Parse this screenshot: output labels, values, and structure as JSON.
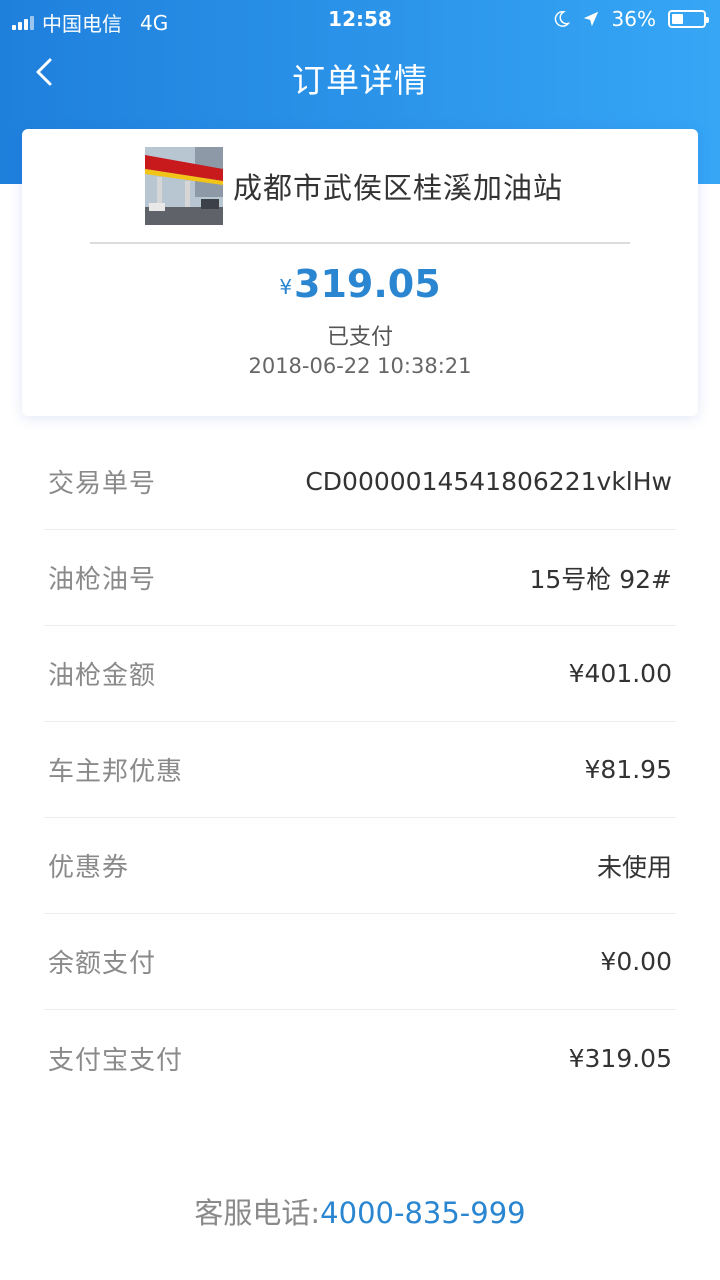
{
  "status_bar": {
    "carrier": "中国电信",
    "network": "4G",
    "time": "12:58",
    "battery": "36%",
    "battery_level": 0.36
  },
  "nav": {
    "title": "订单详情",
    "back_icon": "chevron-left-icon"
  },
  "order": {
    "station_name": "成都市武侯区桂溪加油站",
    "currency_symbol": "¥",
    "amount": "319.05",
    "status": "已支付",
    "time": "2018-06-22 10:38:21"
  },
  "details": [
    {
      "label": "交易单号",
      "value": "CD0000014541806221vklHw"
    },
    {
      "label": "油枪油号",
      "value": "15号枪 92#"
    },
    {
      "label": "油枪金额",
      "value": "¥401.00"
    },
    {
      "label": "车主邦优惠",
      "value": "¥81.95"
    },
    {
      "label": "优惠券",
      "value": "未使用"
    },
    {
      "label": "余额支付",
      "value": "¥0.00"
    },
    {
      "label": "支付宝支付",
      "value": "¥319.05"
    }
  ],
  "footer": {
    "hotline_label": "客服电话:",
    "hotline_number": "4000-835-999"
  },
  "colors": {
    "header_gradient_start": "#1f80dc",
    "header_gradient_end": "#36a6f5",
    "accent": "#2a86d1"
  }
}
